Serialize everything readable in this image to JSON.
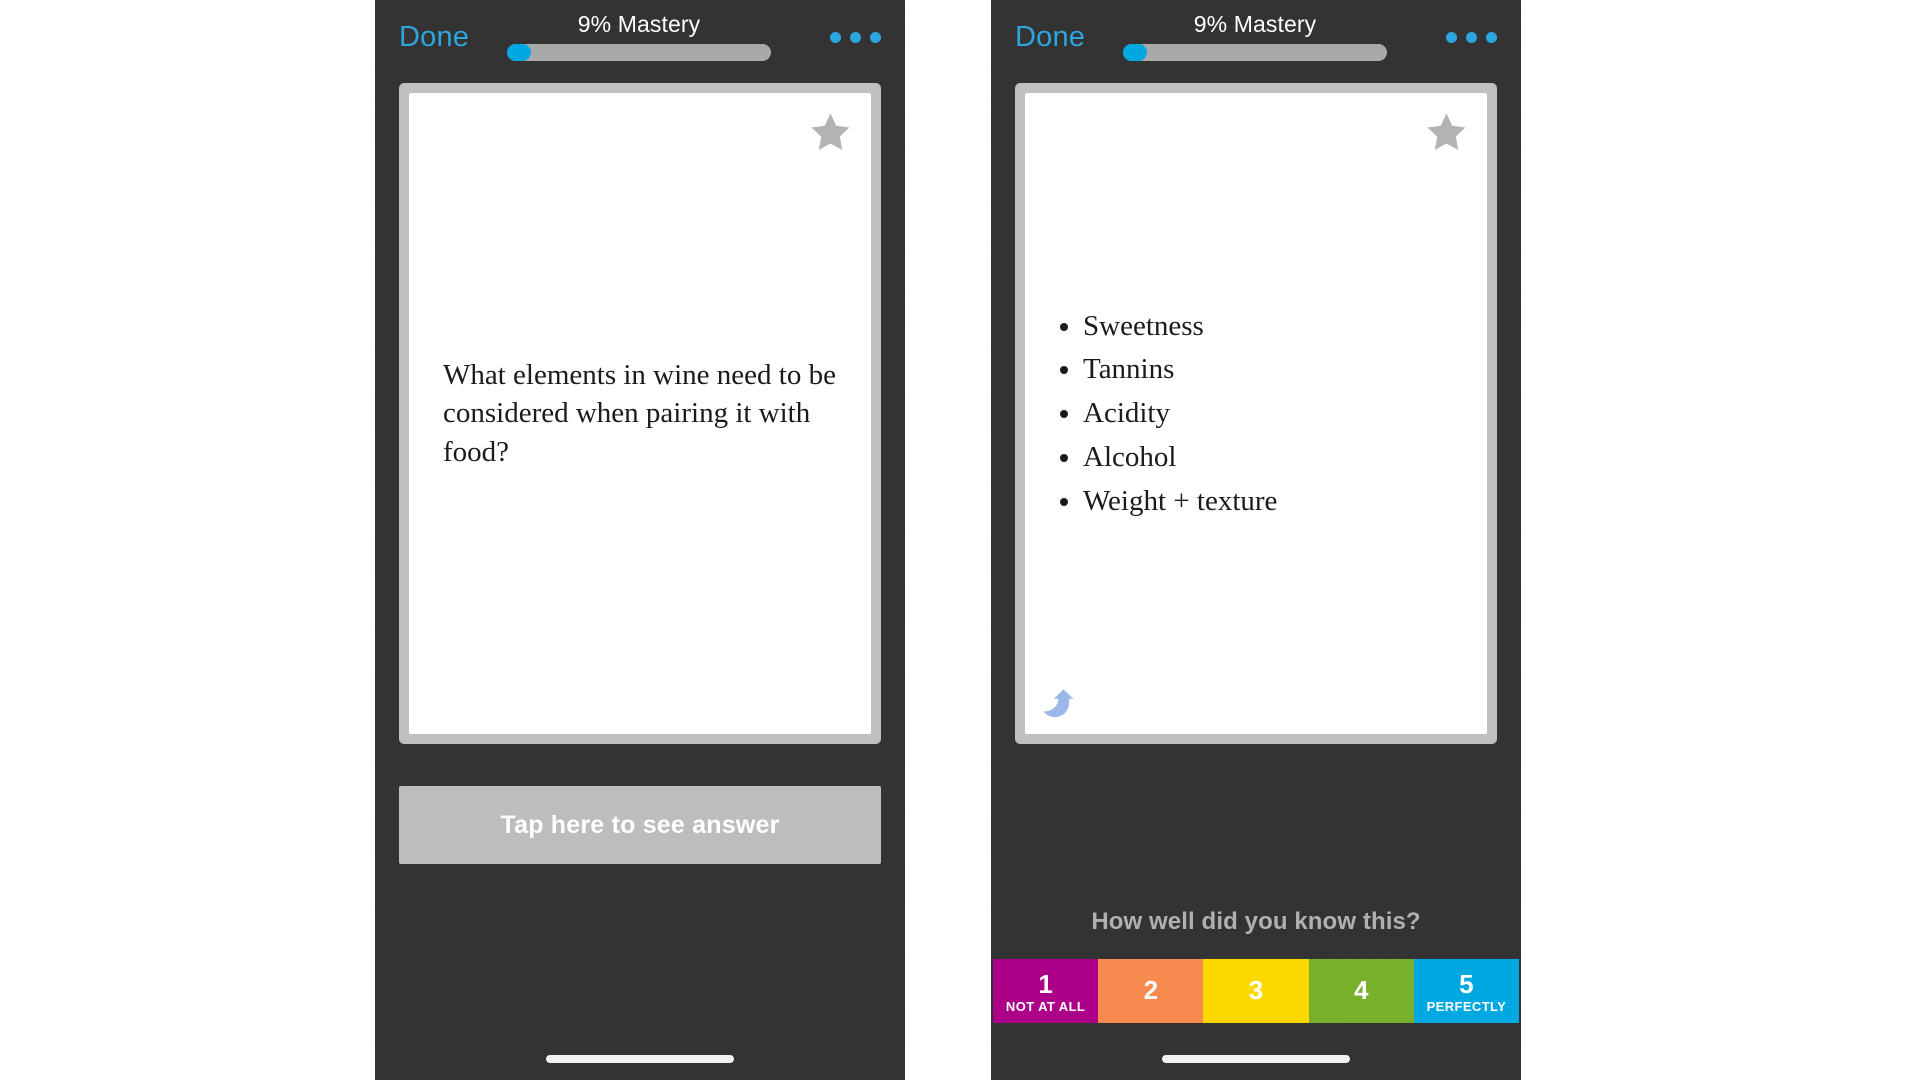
{
  "app": {
    "background_color": "#ffffff",
    "chrome_color": "#333333",
    "accent_blue": "#2ba6de",
    "progress_fill_color": "#00a8e1",
    "progress_track_color": "#a9a9a9"
  },
  "topbar": {
    "done_label": "Done",
    "mastery_label": "9% Mastery",
    "mastery_percent": 9,
    "more_icon": "ellipsis-icon"
  },
  "left_phone": {
    "side": "question",
    "star_icon": "star-icon",
    "question_text": "What elements in wine need to be considered when pairing it with food?",
    "reveal_button_label": "Tap here to see answer"
  },
  "right_phone": {
    "side": "answer",
    "star_icon": "star-icon",
    "undo_icon": "undo-arrow-icon",
    "answer_items": [
      "Sweetness",
      "Tannins",
      "Acidity",
      "Alcohol",
      "Weight + texture"
    ],
    "rate_prompt": "How well did you know this?",
    "rating_buttons": [
      {
        "number": "1",
        "sublabel": "NOT AT ALL",
        "color": "#ab0087"
      },
      {
        "number": "2",
        "sublabel": "",
        "color": "#f68a4f"
      },
      {
        "number": "3",
        "sublabel": "",
        "color": "#fbd900"
      },
      {
        "number": "4",
        "sublabel": "",
        "color": "#77b02a"
      },
      {
        "number": "5",
        "sublabel": "PERFECTLY",
        "color": "#00a8e1"
      }
    ]
  }
}
